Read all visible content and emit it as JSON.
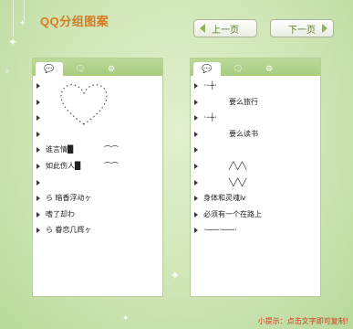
{
  "header": {
    "title": "QQ分组图案",
    "prev_label": "上一页",
    "next_label": "下一页"
  },
  "tabs": [
    {
      "icon": "chat-bubble-icon"
    },
    {
      "icon": "chat-bubbles-icon"
    },
    {
      "icon": "chat-settings-icon"
    }
  ],
  "left_panel": {
    "rows": [
      {
        "text": "",
        "indent": false
      },
      {
        "text": "",
        "indent": false
      },
      {
        "text": "",
        "indent": false
      },
      {
        "text": "",
        "indent": false
      },
      {
        "text": "谁言情█",
        "indent": false,
        "suffix": "⌒⌒"
      },
      {
        "text": "如此伤人█",
        "indent": false,
        "suffix": "⌒⌒"
      },
      {
        "text": "",
        "indent": false
      },
      {
        "text": "ら      暗香浮动ヶ",
        "indent": false
      },
      {
        "text": "嗜了却わ",
        "indent": false
      },
      {
        "text": "ら      眷恋几辉ヶ",
        "indent": false
      }
    ]
  },
  "right_panel": {
    "rows": [
      {
        "text": "·┈┼·",
        "indent": false
      },
      {
        "text": "要么旅行",
        "indent": true
      },
      {
        "text": "·┈┼·",
        "indent": false
      },
      {
        "text": "要么读书",
        "indent": true
      },
      {
        "text": "",
        "indent": false
      },
      {
        "text": "╱╲╱╲",
        "indent": true
      },
      {
        "text": "╲╱╲╱",
        "indent": true
      },
      {
        "text": "身体和灵魂ⅳ",
        "indent": false
      },
      {
        "text": "必须有一个在路上",
        "indent": false
      },
      {
        "text": "·───·───·",
        "indent": false
      }
    ]
  },
  "hint": "小提示：点击文字即可复制!",
  "colors": {
    "title": "#d97a1e",
    "accent": "#8fb35a",
    "hint": "#d43a1a"
  }
}
